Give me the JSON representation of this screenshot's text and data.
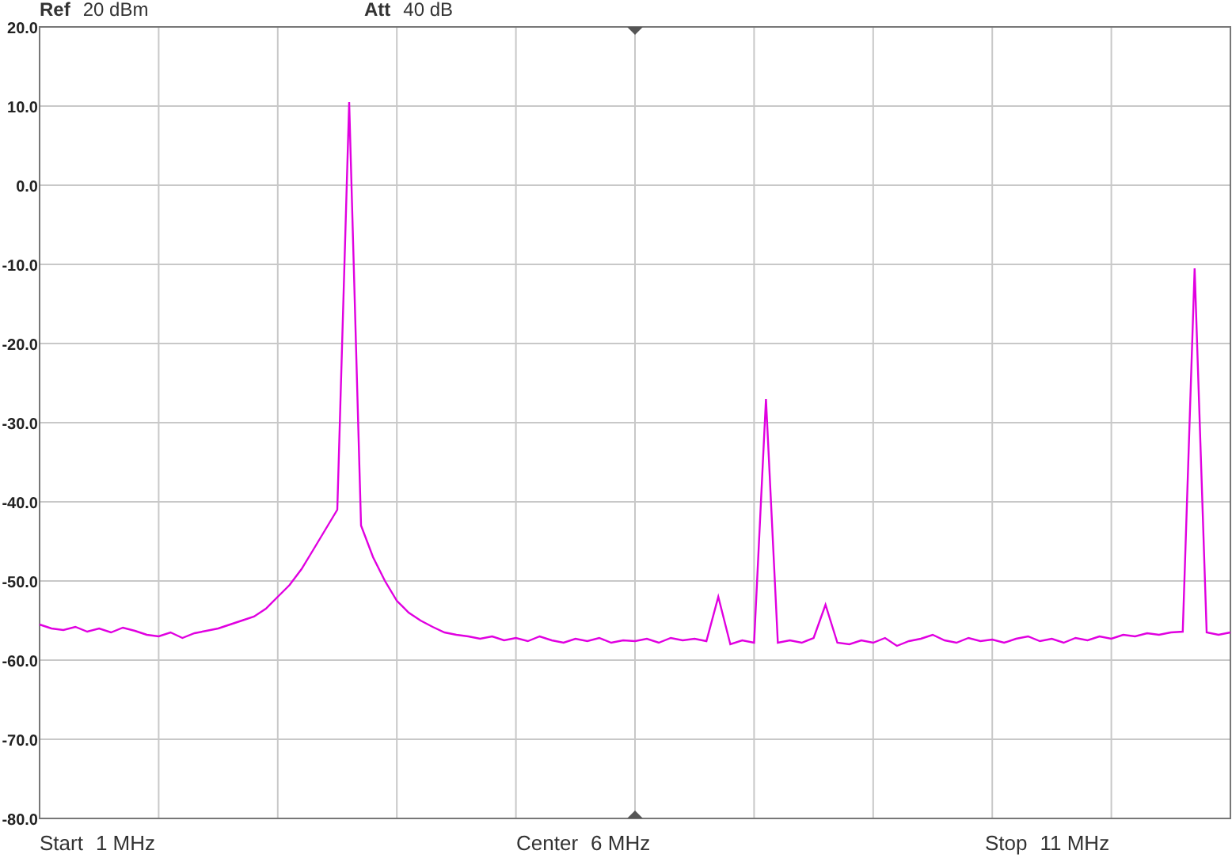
{
  "header": {
    "ref_label": "Ref",
    "ref_value": "20 dBm",
    "att_label": "Att",
    "att_value": "40 dB"
  },
  "chart": {
    "chart_data": {
      "type": "line",
      "grid": true,
      "ylim": [
        -80,
        20
      ],
      "yticks": [
        {
          "value": 20,
          "label": "20.0"
        },
        {
          "value": 10,
          "label": "10.0"
        },
        {
          "value": 0,
          "label": "0.0"
        },
        {
          "value": -10,
          "label": "-10.0"
        },
        {
          "value": -20,
          "label": "-20.0"
        },
        {
          "value": -30,
          "label": "-30.0"
        },
        {
          "value": -40,
          "label": "-40.0"
        },
        {
          "value": -50,
          "label": "-50.0"
        },
        {
          "value": -60,
          "label": "-60.0"
        },
        {
          "value": -70,
          "label": "-70.0"
        },
        {
          "value": -80,
          "label": "-80.0"
        }
      ],
      "categories": [
        null,
        null,
        null,
        null,
        null,
        null,
        null,
        null,
        null,
        null,
        null,
        null,
        null,
        null,
        null,
        null,
        null,
        null,
        null,
        null,
        null,
        null,
        null,
        null,
        null,
        null,
        null,
        null,
        null,
        null,
        null,
        null,
        null,
        null,
        null,
        null,
        null,
        null,
        null,
        null,
        null,
        null,
        null,
        null,
        null,
        null,
        null,
        null,
        null,
        null,
        null,
        null,
        null,
        null,
        null,
        null,
        null,
        null,
        null,
        null,
        null,
        null,
        null,
        null,
        null,
        null,
        null,
        null,
        null,
        null,
        null,
        null,
        null,
        null,
        null,
        null,
        null,
        null,
        null,
        null,
        null,
        null,
        null,
        null,
        null,
        null,
        null,
        null,
        null,
        null,
        null,
        null,
        null,
        null,
        null,
        null,
        null,
        null,
        null,
        null,
        null
      ],
      "series": [
        {
          "color": "#e000e0",
          "values": [
            -55.5,
            -56,
            -56.2,
            -55.8,
            -56.4,
            -56,
            -56.5,
            -55.9,
            -56.3,
            -56.8,
            -57,
            -56.5,
            -57.2,
            -56.6,
            -56.3,
            -56,
            -55.5,
            -55,
            -54.5,
            -53.5,
            -52,
            -50.5,
            -48.5,
            -46,
            -43.5,
            -41,
            10.5,
            -43,
            -47,
            -50,
            -52.5,
            -54,
            -55,
            -55.8,
            -56.5,
            -56.8,
            -57,
            -57.3,
            -57,
            -57.5,
            -57.2,
            -57.6,
            -57,
            -57.5,
            -57.8,
            -57.3,
            -57.6,
            -57.2,
            -57.8,
            -57.5,
            -57.6,
            -57.3,
            -57.8,
            -57.2,
            -57.5,
            -57.3,
            -57.6,
            -52,
            -58,
            -57.5,
            -57.8,
            -27,
            -57.8,
            -57.5,
            -57.8,
            -57.2,
            -53,
            -57.8,
            -58,
            -57.5,
            -57.8,
            -57.2,
            -58.2,
            -57.6,
            -57.3,
            -56.8,
            -57.5,
            -57.8,
            -57.2,
            -57.6,
            -57.4,
            -57.8,
            -57.3,
            -57,
            -57.6,
            -57.3,
            -57.8,
            -57.2,
            -57.5,
            -57,
            -57.3,
            -56.8,
            -57,
            -56.6,
            -56.8,
            -56.5,
            -56.4,
            -10.5,
            -56.5,
            -56.8,
            -56.5
          ]
        }
      ]
    }
  },
  "footer": [
    {
      "label": "Start",
      "value": "1 MHz"
    },
    {
      "label": "Center",
      "value": "6 MHz"
    },
    {
      "label": "Stop",
      "value": "11 MHz"
    }
  ]
}
